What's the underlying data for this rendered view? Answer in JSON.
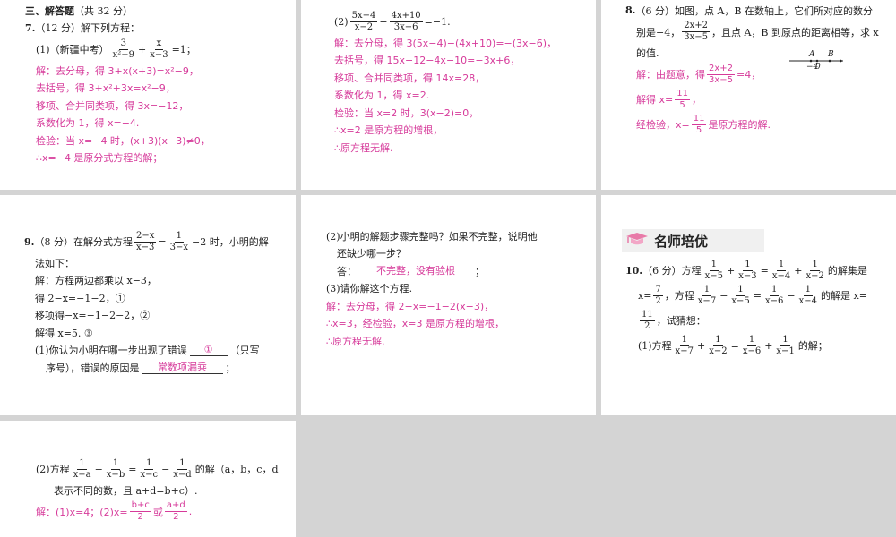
{
  "panels": [
    {
      "id": "p1",
      "lines": [
        {
          "c": "q",
          "i": 0,
          "p": [
            {
              "b": "三、解答题"
            },
            "（共 32 分）"
          ]
        },
        {
          "c": "q",
          "i": 0,
          "p": [
            {
              "b": "7."
            },
            "（12 分）解下列方程："
          ]
        },
        {
          "c": "q",
          "i": 12,
          "p": [
            "(1)（新疆中考）",
            {
              "f": [
                "3",
                "x²−9"
              ]
            },
            "+",
            {
              "f": [
                "x",
                "x−3"
              ]
            },
            "=1；"
          ]
        },
        {
          "c": "ans",
          "i": 12,
          "p": [
            "解：去分母，得 3+x(x+3)=x²−9，"
          ]
        },
        {
          "c": "ans",
          "i": 12,
          "p": [
            "去括号，得 3+x²+3x=x²−9，"
          ]
        },
        {
          "c": "ans",
          "i": 12,
          "p": [
            "移项、合并同类项，得 3x=−12，"
          ]
        },
        {
          "c": "ans",
          "i": 12,
          "p": [
            "系数化为 1，得 x=−4."
          ]
        },
        {
          "c": "ans",
          "i": 12,
          "p": [
            "检验：当 x=−4 时，(x+3)(x−3)≠0，"
          ]
        },
        {
          "c": "ans",
          "i": 12,
          "p": [
            "∴x=−4 是原分式方程的解；"
          ]
        }
      ]
    },
    {
      "id": "p2",
      "lines": [
        {
          "c": "q",
          "i": 0,
          "p": [
            "(2)",
            {
              "f": [
                "5x−4",
                "x−2"
              ]
            },
            "−",
            {
              "f": [
                "4x+10",
                "3x−6"
              ]
            },
            "=−1."
          ]
        },
        {
          "c": "ans",
          "i": 0,
          "p": [
            "解：去分母，得 3(5x−4)−(4x+10)=−(3x−6)，"
          ]
        },
        {
          "c": "ans",
          "i": 0,
          "p": [
            "去括号，得 15x−12−4x−10=−3x+6，"
          ]
        },
        {
          "c": "ans",
          "i": 0,
          "p": [
            "移项、合并同类项，得 14x=28，"
          ]
        },
        {
          "c": "ans",
          "i": 0,
          "p": [
            "系数化为 1，得 x=2."
          ]
        },
        {
          "c": "ans",
          "i": 0,
          "p": [
            "检验：当 x=2 时，3(x−2)=0，"
          ]
        },
        {
          "c": "ans",
          "i": 0,
          "p": [
            "∴x=2 是原方程的增根，"
          ]
        },
        {
          "c": "ans",
          "i": 0,
          "p": [
            "∴原方程无解."
          ]
        }
      ]
    },
    {
      "id": "p3",
      "lines": [
        {
          "c": "q",
          "i": 0,
          "p": [
            {
              "b": "8."
            },
            "（6 分）如图，点 A，B 在数轴上，它们所对应的数分"
          ]
        },
        {
          "c": "q",
          "i": 12,
          "p": [
            "别是−4，",
            {
              "f": [
                "2x+2",
                "3x−5"
              ]
            },
            "，且点 A，B 到原点的距离相等，求 x"
          ]
        },
        {
          "c": "q",
          "i": 12,
          "p": [
            "的值."
          ]
        },
        {
          "c": "ans",
          "i": 12,
          "p": [
            "解：由题意，得",
            {
              "f": [
                "2x+2",
                "3x−5"
              ]
            },
            "=4，"
          ]
        },
        {
          "c": "ans",
          "i": 12,
          "p": [
            "解得 x=",
            {
              "f": [
                "11",
                "5"
              ]
            },
            "，"
          ]
        },
        {
          "c": "ans",
          "i": 12,
          "p": [
            "经检验，x=",
            {
              "f": [
                "11",
                "5"
              ]
            },
            "是原方程的解."
          ]
        }
      ],
      "numberline": {
        "label_a": "A",
        "label_b": "B",
        "tick_a": "−4",
        "tick_0": "0"
      }
    },
    {
      "id": "p4",
      "lines": [
        {
          "c": "q",
          "i": 0,
          "p": [
            {
              "b": "9."
            },
            "（8 分）在解分式方程",
            {
              "f": [
                "2−x",
                "x−3"
              ]
            },
            "=",
            {
              "f": [
                "1",
                "3−x"
              ]
            },
            "−2 时，小明的解"
          ]
        },
        {
          "c": "q",
          "i": 12,
          "p": [
            "法如下："
          ]
        },
        {
          "c": "q",
          "i": 12,
          "p": [
            "解：方程两边都乘以 x−3，"
          ]
        },
        {
          "c": "q",
          "i": 12,
          "p": [
            "得 2−x=−1−2，①"
          ]
        },
        {
          "c": "q",
          "i": 12,
          "p": [
            "移项得−x=−1−2−2，②"
          ]
        },
        {
          "c": "q",
          "i": 12,
          "p": [
            "解得 x=5. ③"
          ]
        },
        {
          "c": "q",
          "i": 12,
          "p": [
            "(1)你认为小明在哪一步出现了错误",
            {
              "blank": "①"
            },
            "（只写"
          ]
        },
        {
          "c": "q",
          "i": 24,
          "p": [
            "序号），错误的原因是",
            {
              "blank": "常数项漏乘"
            },
            "；"
          ]
        }
      ]
    },
    {
      "id": "p5",
      "lines": [
        {
          "c": "q",
          "i": 0,
          "p": [
            "(2)小明的解题步骤完整吗？如果不完整，说明他"
          ]
        },
        {
          "c": "q",
          "i": 12,
          "p": [
            "还缺少哪一步？"
          ]
        },
        {
          "c": "q",
          "i": 12,
          "p": [
            "答：",
            {
              "blank": "不完整，没有验根"
            },
            "；"
          ]
        },
        {
          "c": "q",
          "i": 0,
          "p": [
            "(3)请你解这个方程."
          ]
        },
        {
          "c": "ans",
          "i": 0,
          "p": [
            "解：去分母，得 2−x=−1−2(x−3)，"
          ]
        },
        {
          "c": "ans",
          "i": 0,
          "p": [
            "∴x=3，经检验，x=3 是原方程的增根，"
          ]
        },
        {
          "c": "ans",
          "i": 0,
          "p": [
            "∴原方程无解."
          ]
        }
      ]
    },
    {
      "id": "p6",
      "badge": "名师培优",
      "lines": [
        {
          "c": "q",
          "i": 0,
          "p": [
            {
              "b": "10."
            },
            "（6 分）方程",
            {
              "f": [
                "1",
                "x−5"
              ]
            },
            "+",
            {
              "f": [
                "1",
                "x−3"
              ]
            },
            "=",
            {
              "f": [
                "1",
                "x−4"
              ]
            },
            "+",
            {
              "f": [
                "1",
                "x−2"
              ]
            },
            "的解集是"
          ]
        },
        {
          "c": "q",
          "i": 14,
          "p": [
            "x=",
            {
              "f": [
                "7",
                "2"
              ]
            },
            "，方程",
            {
              "f": [
                "1",
                "x−7"
              ]
            },
            "−",
            {
              "f": [
                "1",
                "x−5"
              ]
            },
            "=",
            {
              "f": [
                "1",
                "x−6"
              ]
            },
            "−",
            {
              "f": [
                "1",
                "x−4"
              ]
            },
            "的解是 x="
          ]
        },
        {
          "c": "q",
          "i": 14,
          "p": [
            {
              "f": [
                "11",
                "2"
              ]
            },
            "，试猜想："
          ]
        },
        {
          "c": "q",
          "i": 14,
          "p": [
            "(1)方程",
            {
              "f": [
                "1",
                "x−7"
              ]
            },
            "+",
            {
              "f": [
                "1",
                "x−2"
              ]
            },
            "=",
            {
              "f": [
                "1",
                "x−6"
              ]
            },
            "+",
            {
              "f": [
                "1",
                "x−1"
              ]
            },
            "的解；"
          ]
        }
      ]
    },
    {
      "id": "p7",
      "lines": [
        {
          "c": "q",
          "i": 0,
          "p": [
            "(2)方程",
            {
              "f": [
                "1",
                "x−a"
              ]
            },
            "−",
            {
              "f": [
                "1",
                "x−b"
              ]
            },
            "=",
            {
              "f": [
                "1",
                "x−c"
              ]
            },
            "−",
            {
              "f": [
                "1",
                "x−d"
              ]
            },
            "的解（a，b，c，d"
          ]
        },
        {
          "c": "q",
          "i": 20,
          "p": [
            "表示不同的数，且 a+d=b+c）."
          ]
        },
        {
          "c": "ans",
          "i": 0,
          "p": [
            "解：(1)x=4；(2)x=",
            {
              "f": [
                "b+c",
                "2"
              ]
            },
            "或",
            {
              "f": [
                "a+d",
                "2"
              ]
            },
            "."
          ]
        }
      ]
    }
  ]
}
